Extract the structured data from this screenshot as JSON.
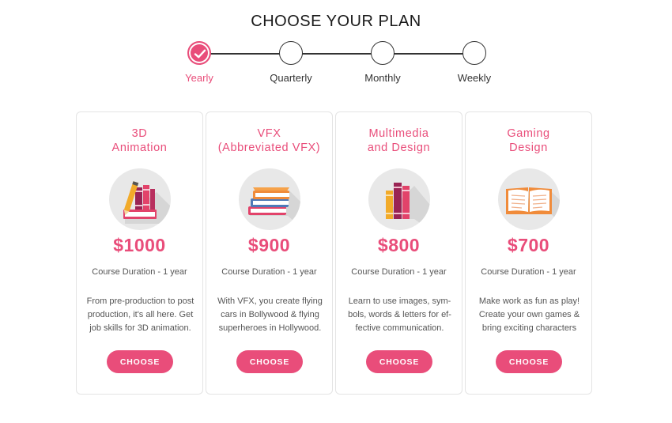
{
  "header": {
    "title": "CHOOSE YOUR PLAN"
  },
  "colors": {
    "accent": "#e94d7a",
    "text": "#555555",
    "card_border": "#e4e4e4"
  },
  "stepper": {
    "selected_index": 0,
    "steps": [
      {
        "label": "Yearly",
        "state": "selected",
        "icon": "check-icon"
      },
      {
        "label": "Quarterly",
        "state": "unselected"
      },
      {
        "label": "Monthly",
        "state": "unselected"
      },
      {
        "label": "Weekly",
        "state": "unselected"
      }
    ]
  },
  "plans": [
    {
      "title": "3D\nAnimation",
      "icon": "books-with-pencil-icon",
      "price": "$1000",
      "duration": "Course Duration - 1 year",
      "description": "From pre-production to post production, it's all here. Get job skills for 3D animation.",
      "button_label": "CHOOSE"
    },
    {
      "title": "VFX\n(Abbreviated VFX)",
      "icon": "stacked-books-icon",
      "price": "$900",
      "duration": "Course Duration - 1 year",
      "description": "With VFX, you create flying cars in Bollywood & flying superheroes in Hollywood.",
      "button_label": "CHOOSE"
    },
    {
      "title": "Multimedia\nand Design",
      "icon": "standing-books-icon",
      "price": "$800",
      "duration": "Course Duration - 1 year",
      "description": "Learn to use images, sym-bols, words & letters for ef-fective communication.",
      "button_label": "CHOOSE"
    },
    {
      "title": "Gaming\nDesign",
      "icon": "open-book-icon",
      "price": "$700",
      "duration": "Course Duration - 1 year",
      "description": "Make work as fun as play! Create your own games & bring exciting characters",
      "button_label": "CHOOSE"
    }
  ]
}
